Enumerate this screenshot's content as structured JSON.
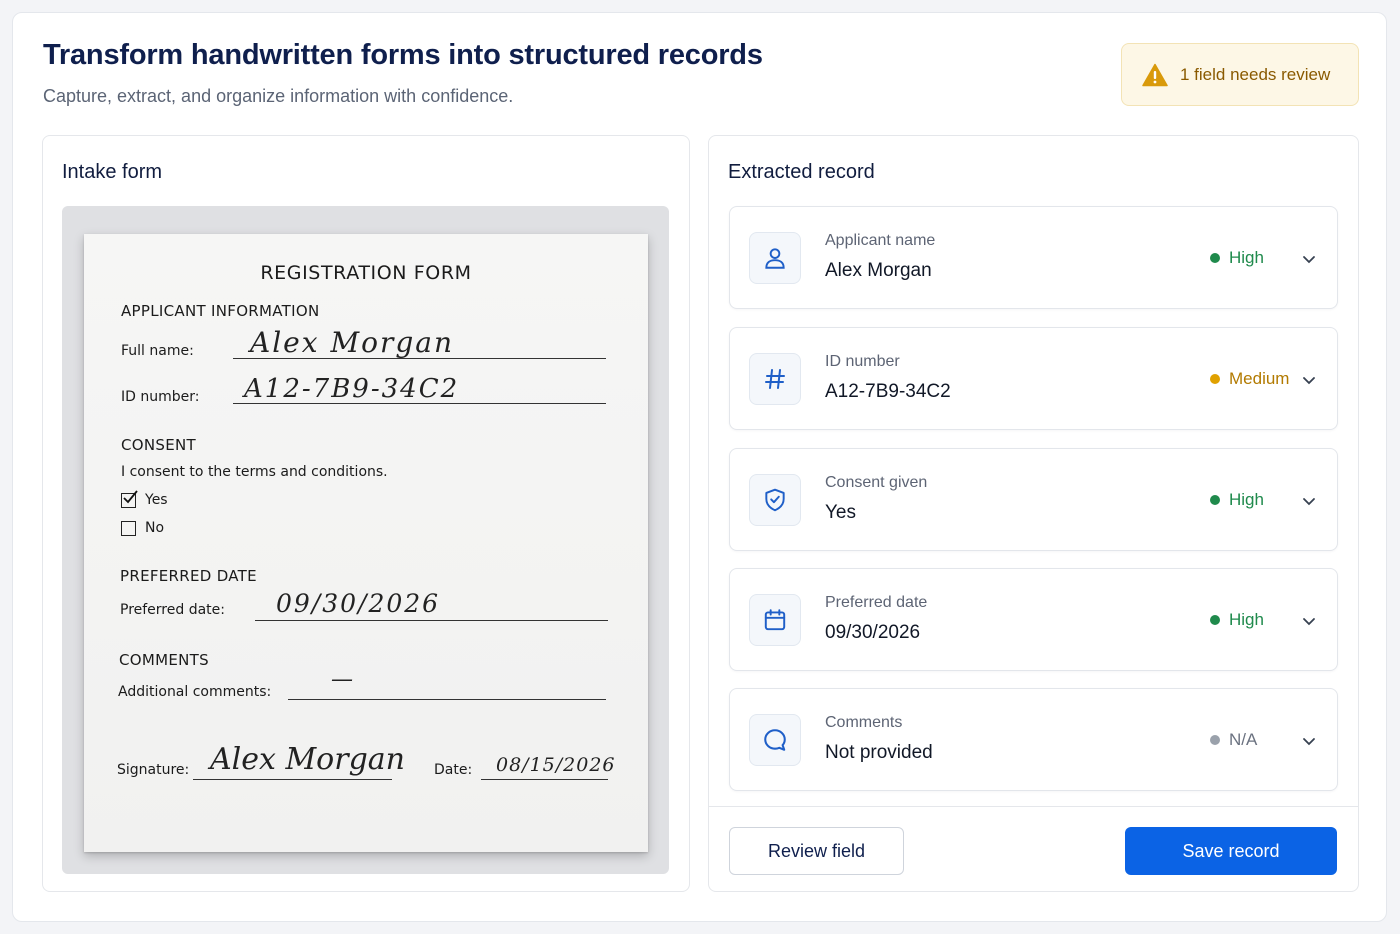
{
  "header": {
    "title": "Transform handwritten forms into structured records",
    "subtitle": "Capture, extract, and organize information with confidence."
  },
  "alert": {
    "text": "1 field needs review",
    "icon": "warning-icon",
    "color": "#d99a0b"
  },
  "intake": {
    "panel_title": "Intake form",
    "form": {
      "title": "REGISTRATION FORM",
      "section_applicant": "APPLICANT INFORMATION",
      "full_name_label": "Full name:",
      "full_name_value": "Alex Morgan",
      "id_label": "ID number:",
      "id_value": "A12-7B9-34C2",
      "section_consent": "CONSENT",
      "consent_text": "I consent to the terms and conditions.",
      "yes_label": "Yes",
      "no_label": "No",
      "section_date": "PREFERRED DATE",
      "date_label": "Preferred date:",
      "date_value": "09/30/2026",
      "section_comments": "COMMENTS",
      "comments_label": "Additional comments:",
      "comments_value": "—",
      "signature_label": "Signature:",
      "signature_value": "Alex Morgan",
      "sign_date_label": "Date:",
      "sign_date_value": "08/15/2026"
    }
  },
  "record": {
    "panel_title": "Extracted record",
    "fields": [
      {
        "label": "Applicant name",
        "value": "Alex Morgan",
        "confidence": "High",
        "icon": "user-icon",
        "color": "#1f8a4c"
      },
      {
        "label": "ID number",
        "value": "A12-7B9-34C2",
        "confidence": "Medium",
        "icon": "hash-icon",
        "color": "#e0a100"
      },
      {
        "label": "Consent given",
        "value": "Yes",
        "confidence": "High",
        "icon": "shield-check-icon",
        "color": "#1f8a4c"
      },
      {
        "label": "Preferred date",
        "value": "09/30/2026",
        "confidence": "High",
        "icon": "calendar-icon",
        "color": "#1f8a4c"
      },
      {
        "label": "Comments",
        "value": "Not provided",
        "confidence": "N/A",
        "icon": "comment-icon",
        "color": "#9aa1ab"
      }
    ],
    "review_button": "Review field",
    "save_button": "Save record"
  },
  "colors": {
    "primary": "#0b63e5",
    "title": "#0f1f4d",
    "icon_blue": "#1f5fc8"
  }
}
